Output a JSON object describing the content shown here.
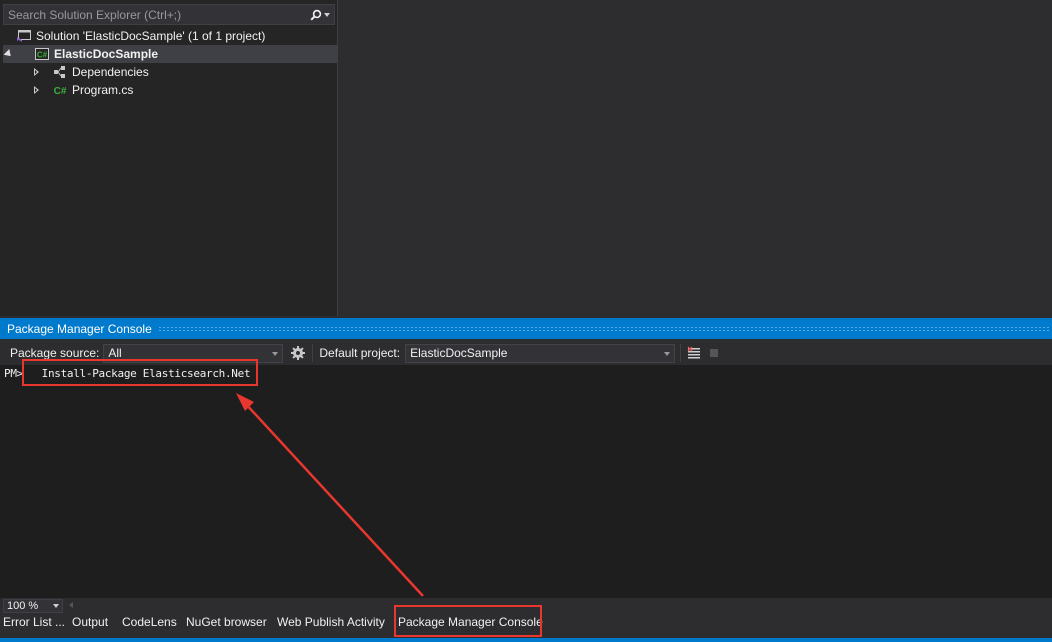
{
  "solution_explorer": {
    "search_placeholder": "Search Solution Explorer (Ctrl+;)",
    "items": [
      {
        "label": "Solution 'ElasticDocSample' (1 of 1 project)"
      },
      {
        "label": "ElasticDocSample"
      },
      {
        "label": "Dependencies"
      },
      {
        "label": "Program.cs"
      }
    ]
  },
  "pmc": {
    "title": "Package Manager Console",
    "package_source_label": "Package source:",
    "package_source_value": "All",
    "default_project_label": "Default project:",
    "default_project_value": "ElasticDocSample",
    "prompt": "PM>",
    "command": "Install-Package Elasticsearch.Net",
    "zoom": "100 %"
  },
  "bottom_tabs": [
    {
      "label": "Error List ..."
    },
    {
      "label": "Output"
    },
    {
      "label": "CodeLens"
    },
    {
      "label": "NuGet browser"
    },
    {
      "label": "Web Publish Activity"
    },
    {
      "label": "Package Manager Console"
    }
  ],
  "colors": {
    "accent": "#007acc",
    "annotation": "#e8372f",
    "panel_bg": "#252526",
    "console_bg": "#1e1e1e",
    "csharp_green": "#3bb03b",
    "vs_purple": "#8a63d2"
  },
  "icons": {
    "search": "search-icon",
    "solution": "solution-icon",
    "csharp_project": "csharp-project-icon",
    "dependencies": "dependencies-icon",
    "csharp_file": "csharp-file-icon",
    "settings": "gear-icon",
    "clear": "clear-console-icon",
    "stop": "stop-icon"
  }
}
